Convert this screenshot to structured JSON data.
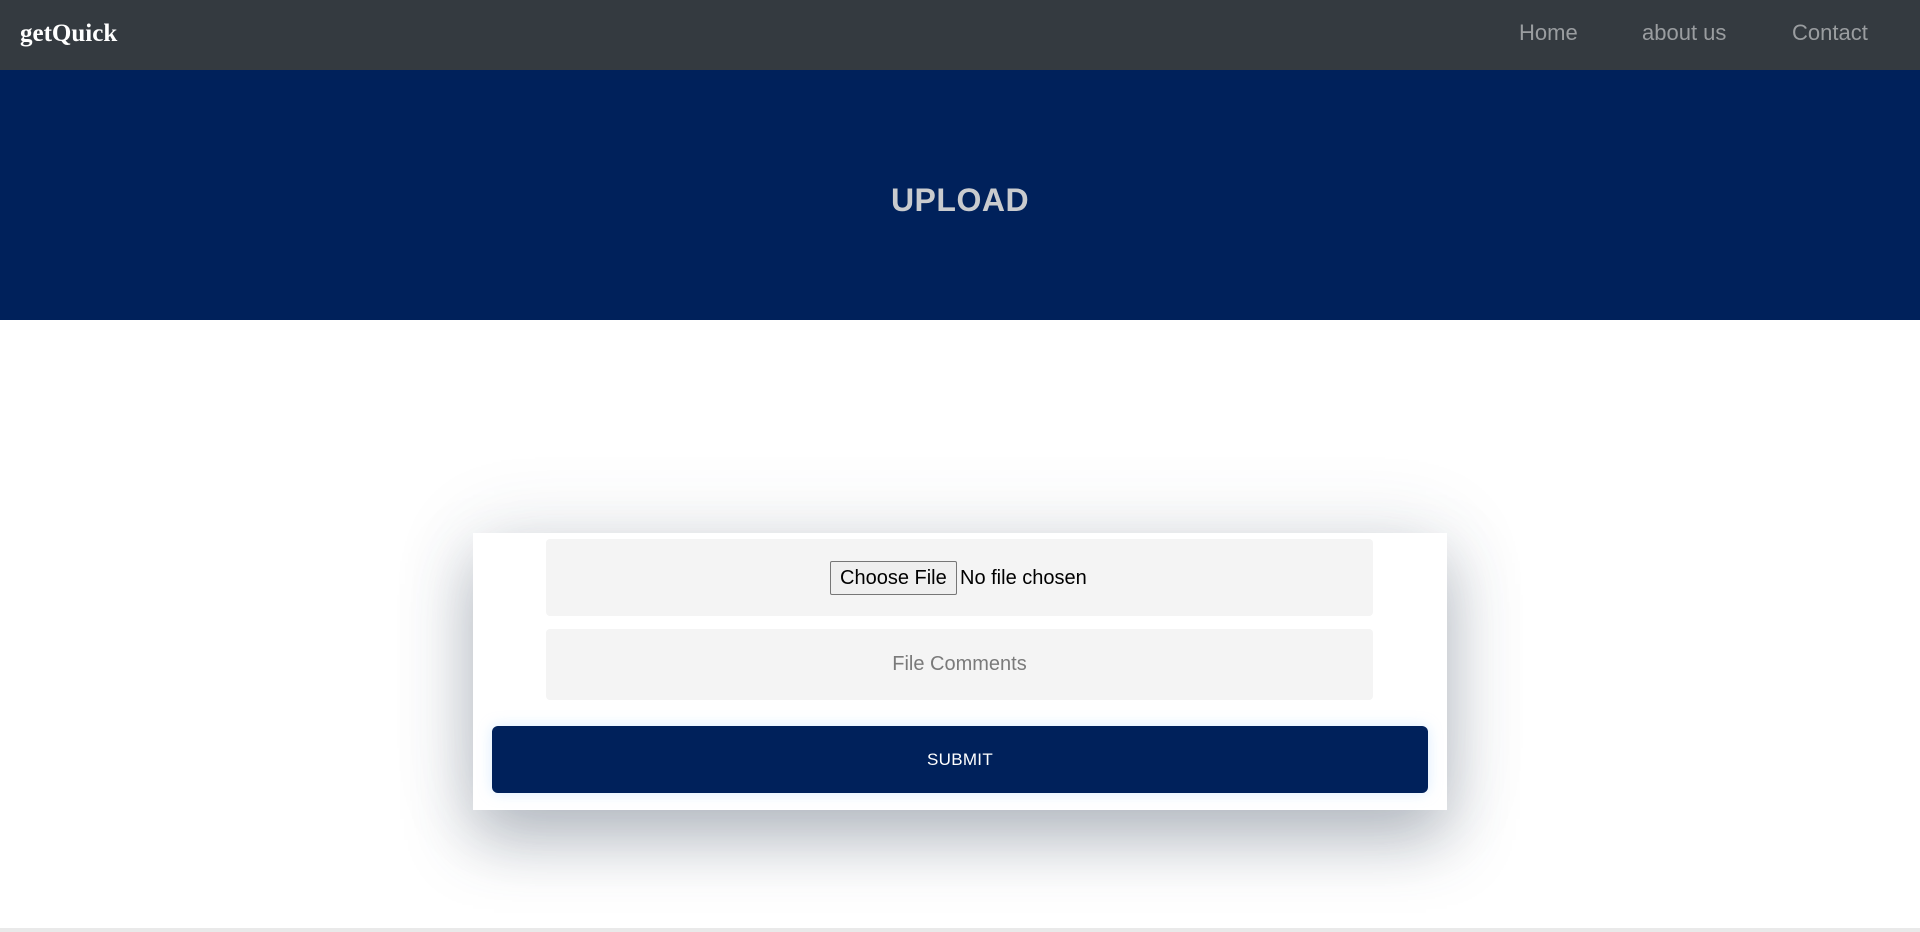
{
  "navbar": {
    "brand": "getQuick",
    "links": [
      {
        "label": "Home"
      },
      {
        "label": "about us"
      },
      {
        "label": "Contact"
      }
    ]
  },
  "hero": {
    "title": "UPLOAD"
  },
  "upload_form": {
    "choose_file_label": "Choose File",
    "file_status": "No file chosen",
    "comments_placeholder": "File Comments",
    "comments_value": "",
    "submit_label": "SUBMIT"
  },
  "colors": {
    "navbar_bg": "#343a40",
    "brand_navy": "#00215b",
    "nav_link": "#9a9da0",
    "field_bg": "#f4f4f4"
  }
}
